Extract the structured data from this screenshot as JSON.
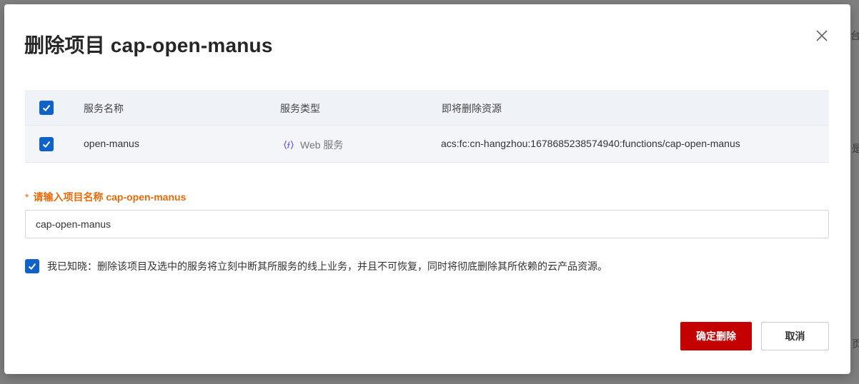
{
  "dialog": {
    "title": "删除项目 cap-open-manus"
  },
  "table": {
    "headers": {
      "name": "服务名称",
      "type": "服务类型",
      "resource": "即将删除资源"
    },
    "header_checked": true,
    "rows": [
      {
        "checked": true,
        "name": "open-manus",
        "type_icon": "function-icon",
        "type": "Web 服务",
        "resource": "acs:fc:cn-hangzhou:1678685238574940:functions/cap-open-manus"
      }
    ]
  },
  "confirm_field": {
    "required_mark": "*",
    "label": "请输入项目名称 cap-open-manus",
    "value": "cap-open-manus"
  },
  "acknowledge": {
    "checked": true,
    "text": "我已知晓：删除该项目及选中的服务将立刻中断其所服务的线上业务，并且不可恢复，同时将彻底删除其所依赖的云产品资源。"
  },
  "buttons": {
    "confirm": "确定删除",
    "cancel": "取消"
  },
  "backdrop_fragments": {
    "top_right": "台",
    "middle_right": "是",
    "bottom_right": "页"
  },
  "colors": {
    "danger": "#c40000",
    "checkbox": "#0f62c7",
    "label_orange": "#ea6a0a"
  }
}
